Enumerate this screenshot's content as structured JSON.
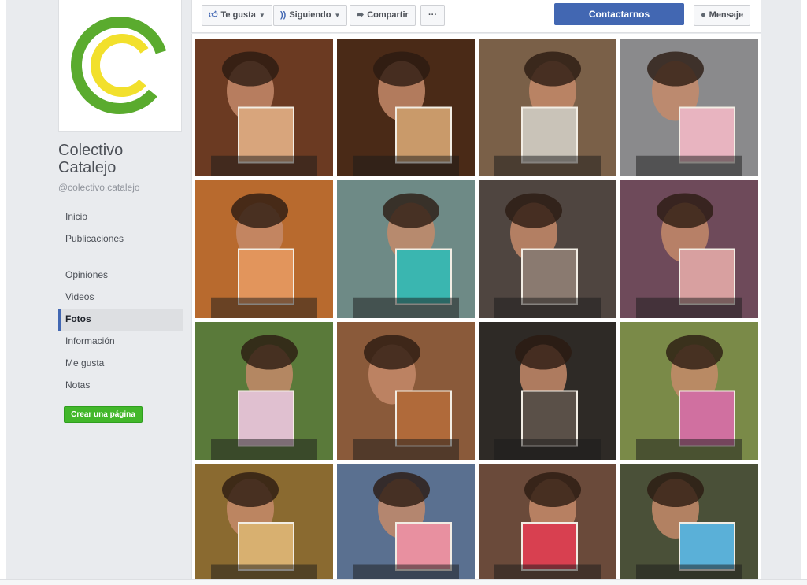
{
  "page": {
    "name": "Colectivo Catalejo",
    "handle": "@colectivo.catalejo"
  },
  "actions": {
    "like": "Te gusta",
    "follow": "Siguiendo",
    "share": "Compartir",
    "more": "···",
    "contact": "Contactarnos",
    "message": "Mensaje"
  },
  "nav": [
    {
      "label": "Inicio"
    },
    {
      "label": "Publicaciones"
    },
    {
      "label": "Opiniones"
    },
    {
      "label": "Videos"
    },
    {
      "label": "Fotos",
      "active": true
    },
    {
      "label": "Información"
    },
    {
      "label": "Me gusta"
    },
    {
      "label": "Notas"
    }
  ],
  "create_page": "Crear una página",
  "colors": {
    "brand_green": "#5aab2e",
    "brand_yellow": "#f2e02c",
    "facebook_blue": "#4267b2",
    "create_green": "#42b72a"
  },
  "photos": [
    {
      "tone": "#6b3a22",
      "accent": "#d8a57c"
    },
    {
      "tone": "#4a2a17",
      "accent": "#c99a6a"
    },
    {
      "tone": "#7a6048",
      "accent": "#c9c3b8"
    },
    {
      "tone": "#8a8a8c",
      "accent": "#e8b4c0"
    },
    {
      "tone": "#b86a2e",
      "accent": "#e2955c"
    },
    {
      "tone": "#6e8a86",
      "accent": "#3ab6b0"
    },
    {
      "tone": "#4f4540",
      "accent": "#8a7a70"
    },
    {
      "tone": "#6e4a5a",
      "accent": "#d8a0a0"
    },
    {
      "tone": "#5a7a3a",
      "accent": "#e0c0d0"
    },
    {
      "tone": "#8a5a3a",
      "accent": "#b06a3a"
    },
    {
      "tone": "#2e2a26",
      "accent": "#5a5048"
    },
    {
      "tone": "#7a8a48",
      "accent": "#d070a0"
    },
    {
      "tone": "#8a6a30",
      "accent": "#d8b070"
    },
    {
      "tone": "#5a7090",
      "accent": "#e890a0"
    },
    {
      "tone": "#6a4a3a",
      "accent": "#d84050"
    },
    {
      "tone": "#4a5038",
      "accent": "#5ab0d8"
    }
  ]
}
